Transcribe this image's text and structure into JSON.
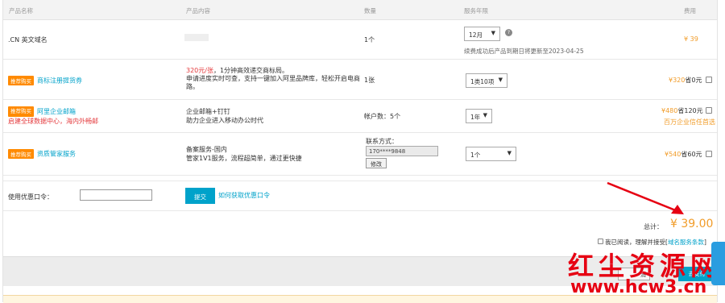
{
  "header": {
    "col_name": "产品名称",
    "col_content": "产品内容",
    "col_qty": "数量",
    "col_years": "服务年限",
    "col_fee": "费用"
  },
  "items": [
    {
      "name": ".CN 英文域名",
      "qty": "1个",
      "select": "12月",
      "note": "续费成功后产品到期日将更新至2023-04-25",
      "price": "¥ 39"
    },
    {
      "tag": "推荐购买",
      "name": "商标注册提货券",
      "content_price": "320元/张",
      "content_desc1": "，1分钟高效递交商标局。",
      "content_desc2": "申请进度实时可查，支持一键加入阿里品牌库，轻松开启电商路。",
      "qty": "1张",
      "select": "1类10项",
      "price": "¥320",
      "save": "省0元"
    },
    {
      "tag": "推荐购买",
      "name": "阿里企业邮箱",
      "sub": "启建全球数据中心，海内外畅邮",
      "content1": "企业邮箱+钉钉",
      "content2": "助力企业进入移动办公时代",
      "qty": "帐户数：5个",
      "select": "1年",
      "price": "¥480",
      "save": "省120元",
      "promo": "百万企业信任首选"
    },
    {
      "tag": "推荐购买",
      "name": "资质管家服务",
      "content1": "备案服务-国内",
      "content2": "管家1V1服务，流程超简单，通过更快捷",
      "contact_label": "联系方式：",
      "contact_value": "170****9848",
      "edit_label": "修改",
      "select": "1个",
      "price": "¥540",
      "save": "省60元"
    }
  ],
  "coupon": {
    "label": "使用优惠口令：",
    "submit": "提交",
    "how_link": "如何获取优惠口令"
  },
  "total": {
    "label": "总计：",
    "value": "¥ 39.00"
  },
  "agreement": {
    "text": "我已阅读，理解并接受[",
    "link": "域名服务条款",
    "end": "]"
  },
  "footer": {
    "cancel_partial": "消",
    "pay_partial": "去支付"
  },
  "watermark": {
    "cn": "红尘资源网",
    "url": "www.hcw3.cn"
  },
  "colors": {
    "accent": "#00a2ca",
    "price": "#f19c29",
    "tag": "#ff8a00",
    "watermark": "#e60012"
  }
}
